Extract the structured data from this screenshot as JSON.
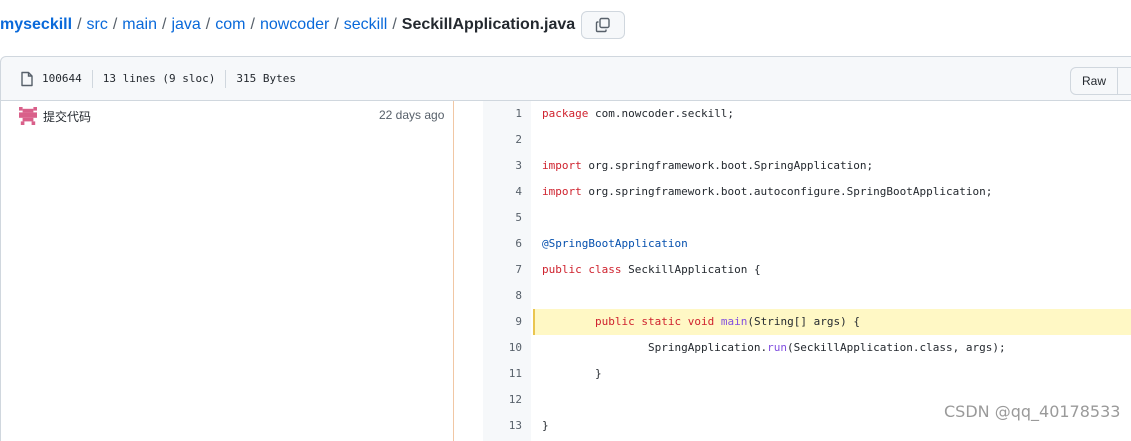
{
  "breadcrumb": {
    "items": [
      "myseckill",
      "src",
      "main",
      "java",
      "com",
      "nowcoder",
      "seckill"
    ],
    "separator": "/",
    "current": "SeckillApplication.java"
  },
  "file_info": {
    "mode": "100644",
    "lines": "13 lines (9 sloc)",
    "size": "315 Bytes",
    "raw_label": "Raw"
  },
  "commit": {
    "message": "提交代码",
    "time": "22 days ago"
  },
  "code": {
    "lines": [
      {
        "n": "1",
        "parts": [
          [
            "kw",
            "package"
          ],
          [
            "t",
            " com.nowcoder.seckill;"
          ]
        ]
      },
      {
        "n": "2",
        "parts": []
      },
      {
        "n": "3",
        "parts": [
          [
            "kw",
            "import"
          ],
          [
            "t",
            " org.springframework.boot.SpringApplication;"
          ]
        ]
      },
      {
        "n": "4",
        "parts": [
          [
            "kw",
            "import"
          ],
          [
            "t",
            " org.springframework.boot.autoconfigure.SpringBootApplication;"
          ]
        ]
      },
      {
        "n": "5",
        "parts": []
      },
      {
        "n": "6",
        "parts": [
          [
            "ann",
            "@SpringBootApplication"
          ]
        ]
      },
      {
        "n": "7",
        "parts": [
          [
            "kw",
            "public"
          ],
          [
            "t",
            " "
          ],
          [
            "kw",
            "class"
          ],
          [
            "t",
            " SeckillApplication {"
          ]
        ]
      },
      {
        "n": "8",
        "parts": []
      },
      {
        "n": "9",
        "parts": [
          [
            "t",
            "        "
          ],
          [
            "kw",
            "public"
          ],
          [
            "t",
            " "
          ],
          [
            "kw",
            "static"
          ],
          [
            "t",
            " "
          ],
          [
            "kw",
            "void"
          ],
          [
            "t",
            " "
          ],
          [
            "fn",
            "main"
          ],
          [
            "t",
            "(String[] args) {"
          ]
        ]
      },
      {
        "n": "10",
        "parts": [
          [
            "t",
            "                SpringApplication."
          ],
          [
            "fn",
            "run"
          ],
          [
            "t",
            "(SeckillApplication.class, args);"
          ]
        ]
      },
      {
        "n": "11",
        "parts": [
          [
            "t",
            "        }"
          ]
        ]
      },
      {
        "n": "12",
        "parts": []
      },
      {
        "n": "13",
        "parts": [
          [
            "t",
            "}"
          ]
        ]
      }
    ],
    "highlighted_line": "9"
  },
  "watermark": "CSDN @qq_40178533",
  "colors": {
    "link": "#0969da",
    "keyword": "#cf222e",
    "annotation": "#0550ae",
    "function": "#8250df",
    "highlight": "#fff8c5"
  },
  "icons": {
    "copy": "copy-icon",
    "file": "file-icon",
    "avatar": "identicon-avatar"
  }
}
